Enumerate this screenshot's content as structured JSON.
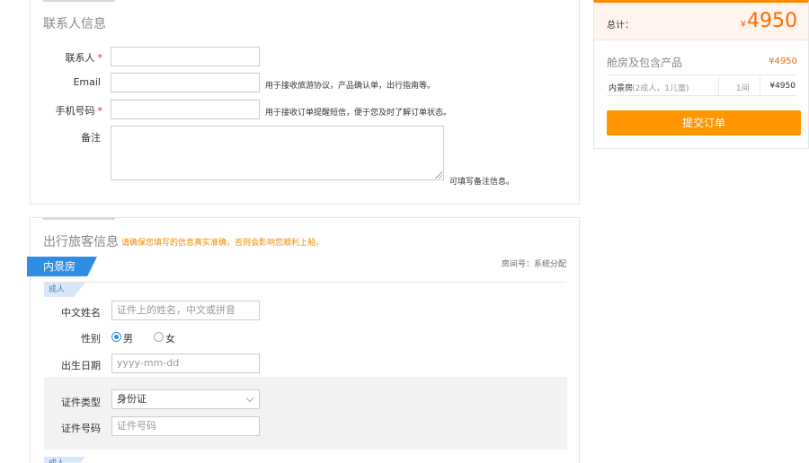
{
  "contact": {
    "title": "联系人信息",
    "name_label": "联系人",
    "required_mark": "*",
    "email_label": "Email",
    "email_hint": "用于接收旅游协议，产品确认单，出行指南等。",
    "phone_label": "手机号码",
    "phone_hint": "用于接收订单提醒短信，便于您及时了解订单状态。",
    "remark_label": "备注",
    "remark_hint": "可填写备注信息。"
  },
  "travelers": {
    "title": "出行旅客信息",
    "warning": "请确保您填写的信息真实准确，否则会影响您顺利上船。",
    "room_type": "内景房",
    "room_no": "房间号：系统分配",
    "adult_tag": "成人",
    "name_label": "中文姓名",
    "name_placeholder": "证件上的姓名，中文或拼音",
    "gender_label": "性别",
    "gender_male": "男",
    "gender_female": "女",
    "birth_label": "出生日期",
    "birth_placeholder": "yyyy-mm-dd",
    "id_type_label": "证件类型",
    "id_type_value": "身份证",
    "id_no_label": "证件号码",
    "id_no_placeholder": "证件号码"
  },
  "summary": {
    "total_label": "总计：",
    "currency": "¥",
    "total_value": "4950",
    "package_title": "舱房及包含产品",
    "package_price": "¥4950",
    "item_name": "内景房",
    "item_detail": "(2成人，1儿童)",
    "item_qty": "1间",
    "item_price": "¥4950",
    "submit_label": "提交订单"
  },
  "colors": {
    "accent_orange": "#ff9500",
    "price_orange": "#ff6a00",
    "room_blue": "#2e8ee6",
    "warning": "#f08a00"
  }
}
